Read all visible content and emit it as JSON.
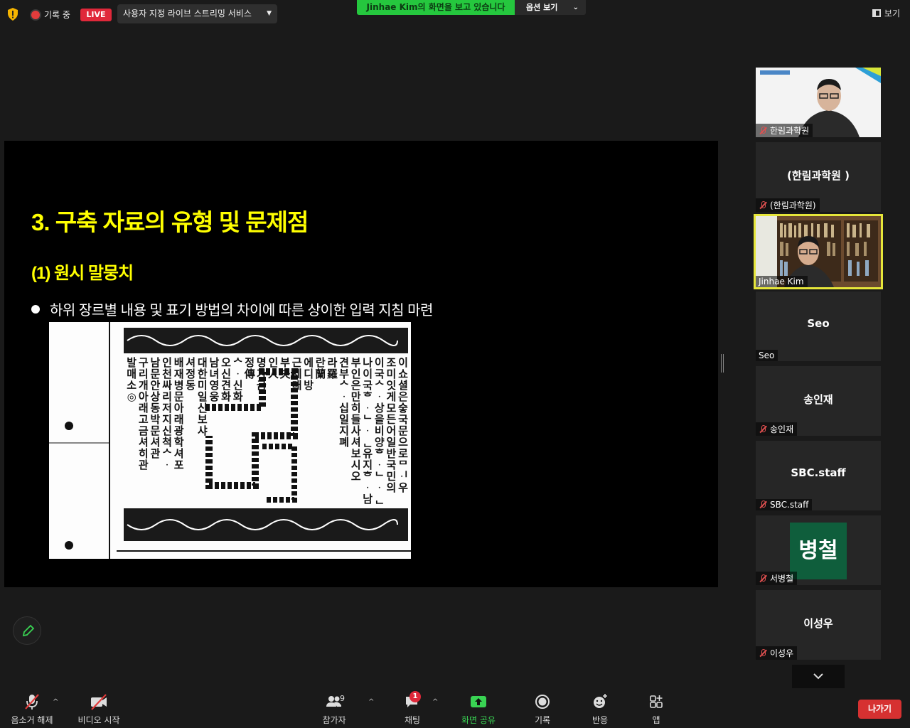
{
  "top": {
    "recording_label": "기록 중",
    "live_label": "LIVE",
    "stream_select": "사용자 지정 라이브 스트리밍 서비스",
    "share_banner": "Jinhae  Kim의 화면을 보고 있습니다",
    "options_label": "옵션 보기",
    "view_label": "보기"
  },
  "slide": {
    "title": "3. 구축 자료의 유형 및 문제점",
    "subtitle": "(1) 원시 말뭉치",
    "bullet": "하위 장르별 내용 및 표기 방법의 차이에 따른 상이한 입력 지침 마련",
    "scan_columns": [
      "이 쇼셜은 숳국문으로 ᄆᆡ우",
      "조미잇게 모든어 일반국민의",
      "이국ᄉᆞ상을 비양ᄒᆞᄂᆞᆫ 취이오",
      "나이국ᄒᆞᄂᆞᆫ 유지ᄒᆞ 남ᄌᆞ와",
      "부인은 만히들 사셔보시오",
      "견 부 ᄉᆞ 십 일 지 폐",
      "라 羅",
      "란 蘭",
      "에 디 방",
      "근 세 대",
      "부 夫",
      "인 人",
      "명 가 금",
      "정 傳",
      "ᄉᆞ 신 화",
      "오 신 견 화",
      "남 녀 영 웅",
      "대 한 미 일 신 보 샤",
      "셔 정 동",
      "배 재 병 문 아 래 광 학 셔 포",
      "인 천 싸 리 저 지 신 척 ᄉᆞ",
      "남 문 안 상 동 박 문 셔 관",
      "구 리 개 아 래 고 금 셔 히 관",
      "발 매 소 ◎"
    ]
  },
  "participants": [
    {
      "name": "한림과학원",
      "type": "video",
      "muted": true
    },
    {
      "name": "(한림과학원)",
      "big": "(한림과학원 )",
      "type": "name",
      "muted": true
    },
    {
      "name": "Jinhae Kim",
      "type": "video",
      "muted": false,
      "active": true
    },
    {
      "name": "Seo",
      "big": "Seo",
      "type": "name",
      "muted": false
    },
    {
      "name": "송인재",
      "big": "송인재",
      "type": "name",
      "muted": true
    },
    {
      "name": "SBC.staff",
      "big": "SBC.staff",
      "type": "name",
      "muted": true
    },
    {
      "name": "서병철",
      "avatar": "병철",
      "type": "avatar",
      "muted": true
    },
    {
      "name": "이성우",
      "big": "이성우",
      "type": "name",
      "muted": true
    }
  ],
  "toolbar": {
    "audio": "음소거 해제",
    "video": "비디오 시작",
    "participants": "참가자",
    "participants_count": "9",
    "chat": "채팅",
    "chat_badge": "1",
    "share": "화면 공유",
    "record": "기록",
    "reactions": "반응",
    "apps": "앱",
    "leave": "나가기"
  },
  "colors": {
    "accent_green": "#25c73e",
    "live_red": "#e0283a",
    "slide_title": "#ffff00",
    "active_border": "#e6e63a"
  }
}
